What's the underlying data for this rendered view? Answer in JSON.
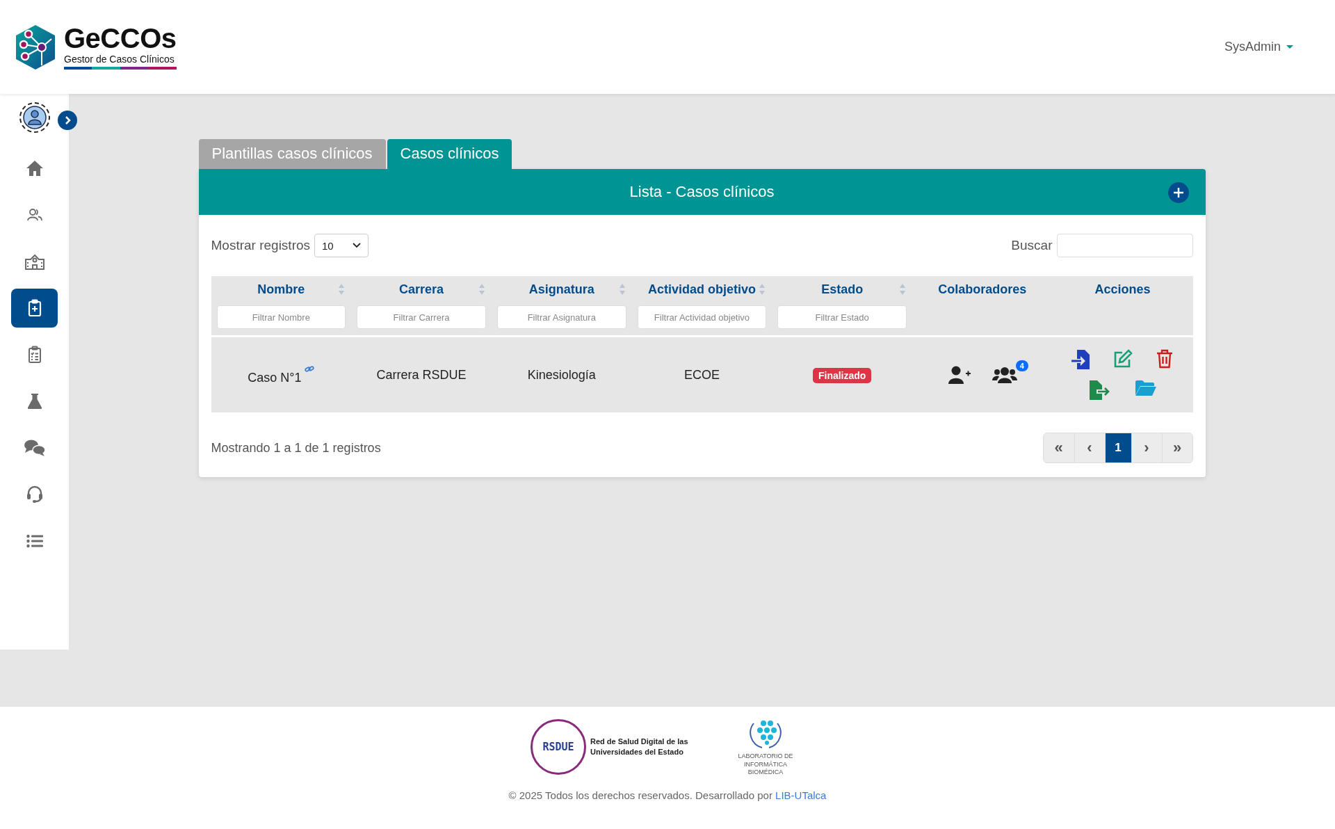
{
  "header": {
    "logo": {
      "title": "GeCCOs",
      "subtitle": "Gestor de Casos Clínicos"
    },
    "user_menu": {
      "label": "SysAdmin"
    }
  },
  "sidebar": {
    "items": [
      {
        "kind": "home",
        "selected": false
      },
      {
        "kind": "users",
        "selected": false
      },
      {
        "kind": "school",
        "selected": false
      },
      {
        "kind": "clipboard-plus",
        "selected": true
      },
      {
        "kind": "checklist",
        "selected": false
      },
      {
        "kind": "flask",
        "selected": false
      },
      {
        "kind": "chat",
        "selected": false
      },
      {
        "kind": "headset",
        "selected": false
      },
      {
        "kind": "list",
        "selected": false
      }
    ]
  },
  "tabs": [
    {
      "label": "Plantillas casos clínicos",
      "selected": false
    },
    {
      "label": "Casos clínicos",
      "selected": true
    }
  ],
  "card": {
    "title": "Lista - Casos clínicos",
    "length_label": "Mostrar registros",
    "length_value": "10",
    "search_label": "Buscar",
    "table": {
      "columns": [
        {
          "label": "Nombre",
          "sortable": true,
          "placeholder": "Filtrar Nombre"
        },
        {
          "label": "Carrera",
          "sortable": true,
          "placeholder": "Filtrar Carrera"
        },
        {
          "label": "Asignatura",
          "sortable": true,
          "placeholder": "Filtrar Asignatura"
        },
        {
          "label": "Actividad objetivo",
          "sortable": true,
          "placeholder": "Filtrar Actividad objetivo"
        },
        {
          "label": "Estado",
          "sortable": true,
          "placeholder": "Filtrar Estado"
        },
        {
          "label": "Colaboradores",
          "sortable": false
        },
        {
          "label": "Acciones",
          "sortable": false
        }
      ],
      "rows": [
        {
          "nombre": "Caso N°1",
          "carrera": "Carrera RSDUE",
          "asignatura": "Kinesiología",
          "actividad": "ECOE",
          "estado": "Finalizado",
          "colaboradores_count": "4"
        }
      ]
    },
    "info": "Mostrando 1 a 1 de 1 registros",
    "pagination": [
      {
        "label": "«",
        "selected": false
      },
      {
        "label": "‹",
        "selected": false
      },
      {
        "label": "1",
        "selected": true
      },
      {
        "label": "›",
        "selected": false
      },
      {
        "label": "»",
        "selected": false
      }
    ]
  },
  "footer": {
    "rsdue_logo": "RSDUE",
    "rsdue_name": "Red de Salud Digital de las Universidades del Estado",
    "lab_name": "LABORATORIO DE INFORMÁTICA BIOMÉDICA",
    "copyright": "© 2025 Todos los derechos reservados. Desarrollado por ",
    "link": "LIB-UTalca"
  }
}
